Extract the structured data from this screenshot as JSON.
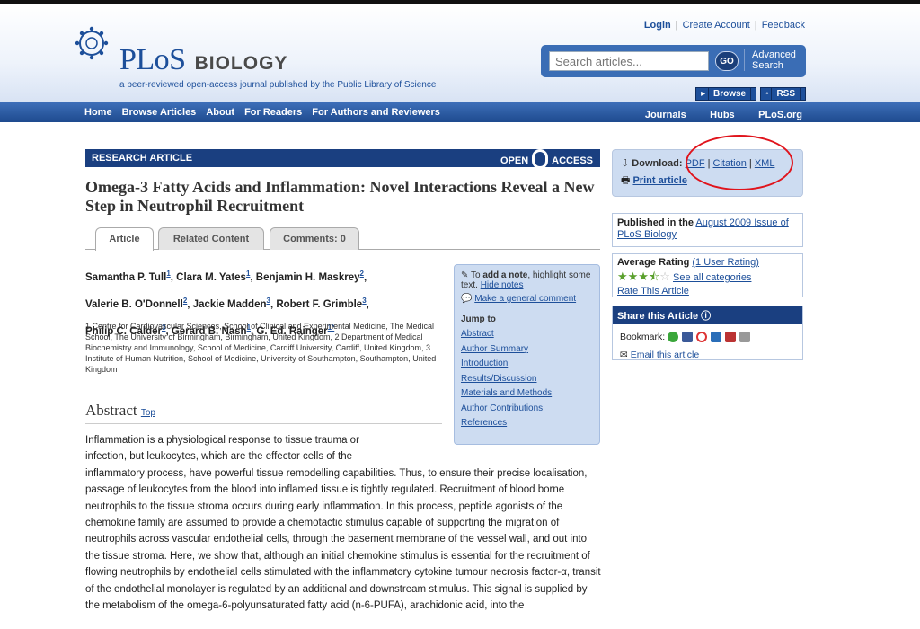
{
  "header": {
    "brand_main": "PLoS",
    "brand_sub": "BIOLOGY",
    "tagline": "a peer-reviewed open-access journal published by the Public Library of Science",
    "login": "Login",
    "create_account": "Create Account",
    "feedback": "Feedback",
    "separator": "|",
    "search_placeholder": "Search articles...",
    "go": "GO",
    "advanced_search": "Advanced Search",
    "browse_btn": "Browse",
    "rss_btn": "RSS"
  },
  "nav": {
    "left": [
      "Home",
      "Browse Articles",
      "About",
      "For Readers",
      "For Authors and Reviewers"
    ],
    "right": [
      "Journals",
      "Hubs",
      "PLoS.org"
    ]
  },
  "article": {
    "type_label": "RESEARCH ARTICLE",
    "open": "OPEN",
    "access": "ACCESS",
    "title": "Omega-3 Fatty Acids and Inflammation: Novel Interactions Reveal a New Step in Neutrophil Recruitment",
    "tabs": [
      "Article",
      "Related Content",
      "Comments: 0"
    ],
    "authors_line1": [
      "Samantha P. Tull",
      "Clara M. Yates",
      "Benjamin H. Maskrey"
    ],
    "authors_line1_sup": [
      "1",
      "1",
      "2"
    ],
    "authors_line2": [
      "Valerie B. O'Donnell",
      "Jackie Madden",
      "Robert F. Grimble"
    ],
    "authors_line2_sup": [
      "2",
      "3",
      "3"
    ],
    "authors_line3": [
      "Philip C. Calder",
      "Gerard B. Nash",
      "G. Ed. Rainger"
    ],
    "authors_line3_sup": [
      "3",
      "1",
      "1*"
    ],
    "affiliations": "1 Centre for Cardiovascular Sciences, School of Clinical and Experimental Medicine, The Medical School, The University of Birmingham, Birmingham, United Kingdom, 2 Department of Medical Biochemistry and Immunology, School of Medicine, Cardiff University, Cardiff, United Kingdom, 3 Institute of Human Nutrition, School of Medicine, University of Southampton, Southampton, United Kingdom",
    "abstract_heading": "Abstract",
    "top_link": "Top",
    "abstract_p1": "Inflammation is a physiological response to tissue trauma or infection, but leukocytes, which are the effector cells of the",
    "abstract_p2": "inflammatory process, have powerful tissue remodelling capabilities. Thus, to ensure their precise localisation, passage of leukocytes from the blood into inflamed tissue is tightly regulated. Recruitment of blood borne neutrophils to the tissue stroma occurs during early inflammation. In this process, peptide agonists of the chemokine family are assumed to provide a chemotactic stimulus capable of supporting the migration of neutrophils across vascular endothelial cells, through the basement membrane of the vessel wall, and out into the tissue stroma. Here, we show that, although an initial chemokine stimulus is essential for the recruitment of flowing neutrophils by endothelial cells stimulated with the inflammatory cytokine tumour necrosis factor-α, transit of the endothelial monolayer is regulated by an additional and downstream stimulus. This signal is supplied by the metabolism of the omega-6-polyunsaturated fatty acid (n-6-PUFA), arachidonic acid, into the"
  },
  "notes": {
    "to": "To",
    "add_note": "add a note",
    "highlight": ", highlight some text.",
    "hide_notes": "Hide notes",
    "general_comment": "Make a general comment",
    "jump_to": "Jump to",
    "jump_links": [
      "Abstract",
      "Author Summary",
      "Introduction",
      "Results/Discussion",
      "Materials and Methods",
      "Author Contributions",
      "References"
    ]
  },
  "sidebar": {
    "download_label": "Download:",
    "pdf": "PDF",
    "citation": "Citation",
    "xml": "XML",
    "print": "Print article",
    "published_in": "Published in the",
    "issue_link": "August 2009 Issue of PLoS Biology",
    "average_rating": "Average Rating",
    "user_rating": "(1 User Rating)",
    "see_all": "See all categories",
    "rate_article": "Rate This Article",
    "rating": 3.5,
    "rating_max": 5,
    "share_title": "Share this Article",
    "bookmark": "Bookmark:",
    "email": "Email this article"
  },
  "colors": {
    "brand_blue": "#1d4f9a",
    "nav_blue": "#1e4a8e",
    "annotation_red": "#e0141c"
  }
}
